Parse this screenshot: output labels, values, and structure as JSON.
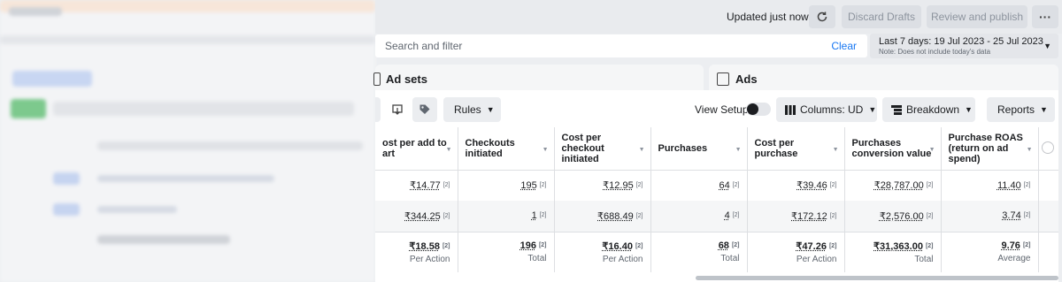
{
  "header": {
    "updated_text": "Updated just now",
    "discard_label": "Discard Drafts",
    "review_label": "Review and publish",
    "more_label": "···",
    "refresh_icon": "refresh-icon"
  },
  "search": {
    "placeholder": "Search and filter",
    "clear_label": "Clear"
  },
  "date_range": {
    "label": "Last 7 days: 19 Jul 2023 - 25 Jul 2023",
    "note": "Note: Does not include today's data"
  },
  "tabs": [
    {
      "label": "Ad sets",
      "icon": "ad-sets-icon"
    },
    {
      "label": "Ads",
      "icon": "ads-icon"
    }
  ],
  "toolbar": {
    "rules_label": "Rules",
    "view_setup_label": "View Setup",
    "columns_label": "Columns: UD",
    "breakdown_label": "Breakdown",
    "reports_label": "Reports"
  },
  "table": {
    "columns": [
      "ost per add to art",
      "Checkouts initiated",
      "Cost per checkout initiated",
      "Purchases",
      "Cost per purchase",
      "Purchases conversion value",
      "Purchase ROAS (return on ad spend)"
    ],
    "footnote_marker": "[2]",
    "rows": [
      [
        "₹14.77",
        "195",
        "₹12.95",
        "64",
        "₹39.46",
        "₹28,787.00",
        "11.40"
      ],
      [
        "₹344.25",
        "1",
        "₹688.49",
        "4",
        "₹172.12",
        "₹2,576.00",
        "3.74"
      ]
    ],
    "totals": {
      "values": [
        "₹18.58",
        "196",
        "₹16.40",
        "68",
        "₹47.26",
        "₹31,363.00",
        "9.76"
      ],
      "labels": [
        "Per Action",
        "Total",
        "Per Action",
        "Total",
        "Per Action",
        "Total",
        "Average"
      ]
    }
  },
  "colors": {
    "link_blue": "#1877f2",
    "border": "#dddfe2"
  }
}
